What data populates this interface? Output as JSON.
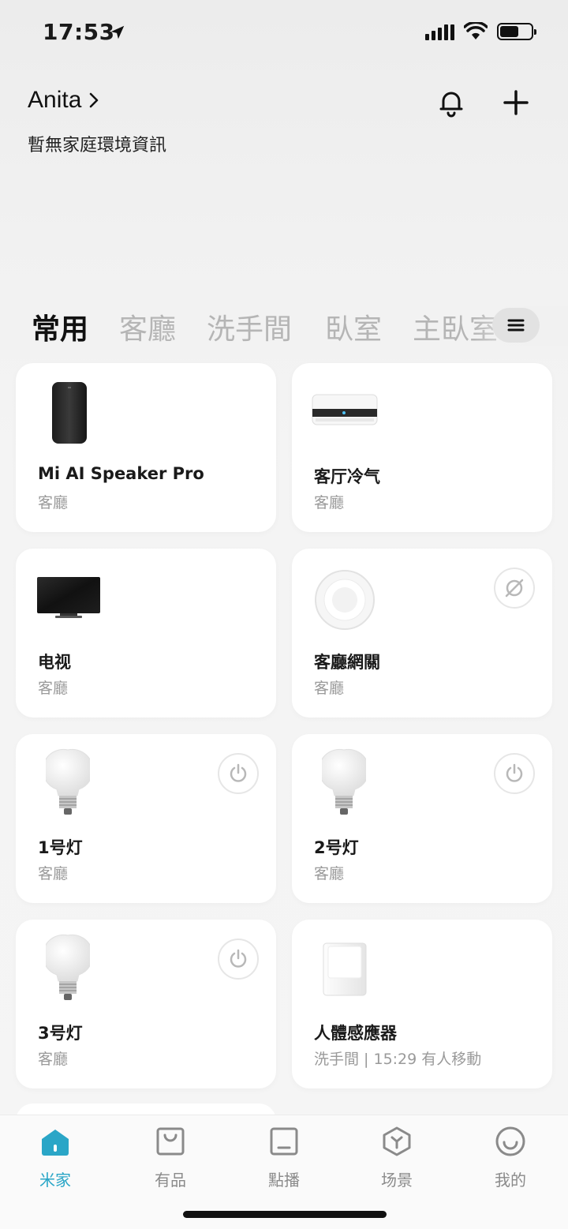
{
  "status": {
    "time": "17:53"
  },
  "header": {
    "home_name": "Anita",
    "subtitle": "暫無家庭環境資訊"
  },
  "room_tabs": [
    "常用",
    "客廳",
    "洗手間",
    "臥室",
    "主臥室"
  ],
  "devices": [
    {
      "name": "Mi AI Speaker Pro",
      "room": "客廳",
      "icon": "speaker"
    },
    {
      "name": "客厅冷气",
      "room": "客廳",
      "icon": "air-conditioner"
    },
    {
      "name": "电视",
      "room": "客廳",
      "icon": "tv"
    },
    {
      "name": "客廳網關",
      "room": "客廳",
      "icon": "gateway"
    },
    {
      "name": "1号灯",
      "room": "客廳",
      "icon": "bulb"
    },
    {
      "name": "2号灯",
      "room": "客廳",
      "icon": "bulb"
    },
    {
      "name": "3号灯",
      "room": "客廳",
      "icon": "bulb"
    },
    {
      "name": "人體感應器",
      "room": "洗手間 | 15:29 有人移動",
      "icon": "motion-sensor"
    }
  ],
  "bottom_nav": [
    {
      "label": "米家",
      "icon": "home-icon",
      "active": true
    },
    {
      "label": "有品",
      "icon": "bag-icon"
    },
    {
      "label": "點播",
      "icon": "tablet-icon"
    },
    {
      "label": "场景",
      "icon": "cube-icon"
    },
    {
      "label": "我的",
      "icon": "smile-icon"
    }
  ],
  "colors": {
    "accent": "#2aa6c7",
    "text": "#1a1a1a",
    "muted": "#9a9a9a"
  }
}
